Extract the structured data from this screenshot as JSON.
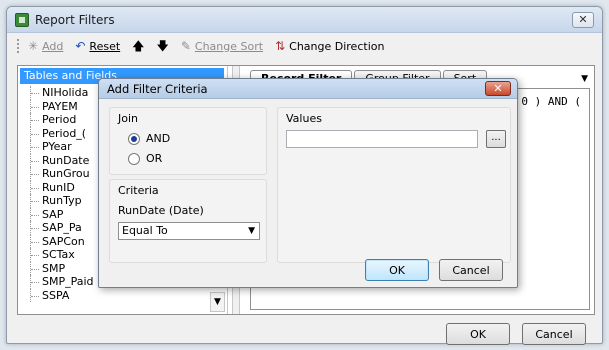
{
  "window": {
    "title": "Report Filters"
  },
  "toolbar": {
    "add": "Add",
    "reset": "Reset",
    "change_sort": "Change Sort",
    "change_direction": "Change Direction"
  },
  "left_panel": {
    "header": "Tables and Fields",
    "items": [
      "NIHolida",
      "PAYEM",
      "Period",
      "Period_(",
      "PYear",
      "RunDate",
      "RunGrou",
      "RunID",
      "RunTyp",
      "SAP",
      "SAP_Pa",
      "SAPCon",
      "SCTax",
      "SMP",
      "SMP_Paid",
      "SSPA"
    ]
  },
  "tabs": [
    "Record Filter",
    "Group Filter",
    "Sort"
  ],
  "filter_text": "0 ) AND (",
  "bottom_buttons": {
    "ok": "OK",
    "cancel": "Cancel"
  },
  "dialog": {
    "title": "Add Filter Criteria",
    "join_label": "Join",
    "join_options": [
      "AND",
      "OR"
    ],
    "join_selected": "AND",
    "criteria_label": "Criteria",
    "criteria_field": "RunDate (Date)",
    "operator": "Equal To",
    "values_label": "Values",
    "value": "",
    "browse": "...",
    "ok": "OK",
    "cancel": "Cancel"
  }
}
